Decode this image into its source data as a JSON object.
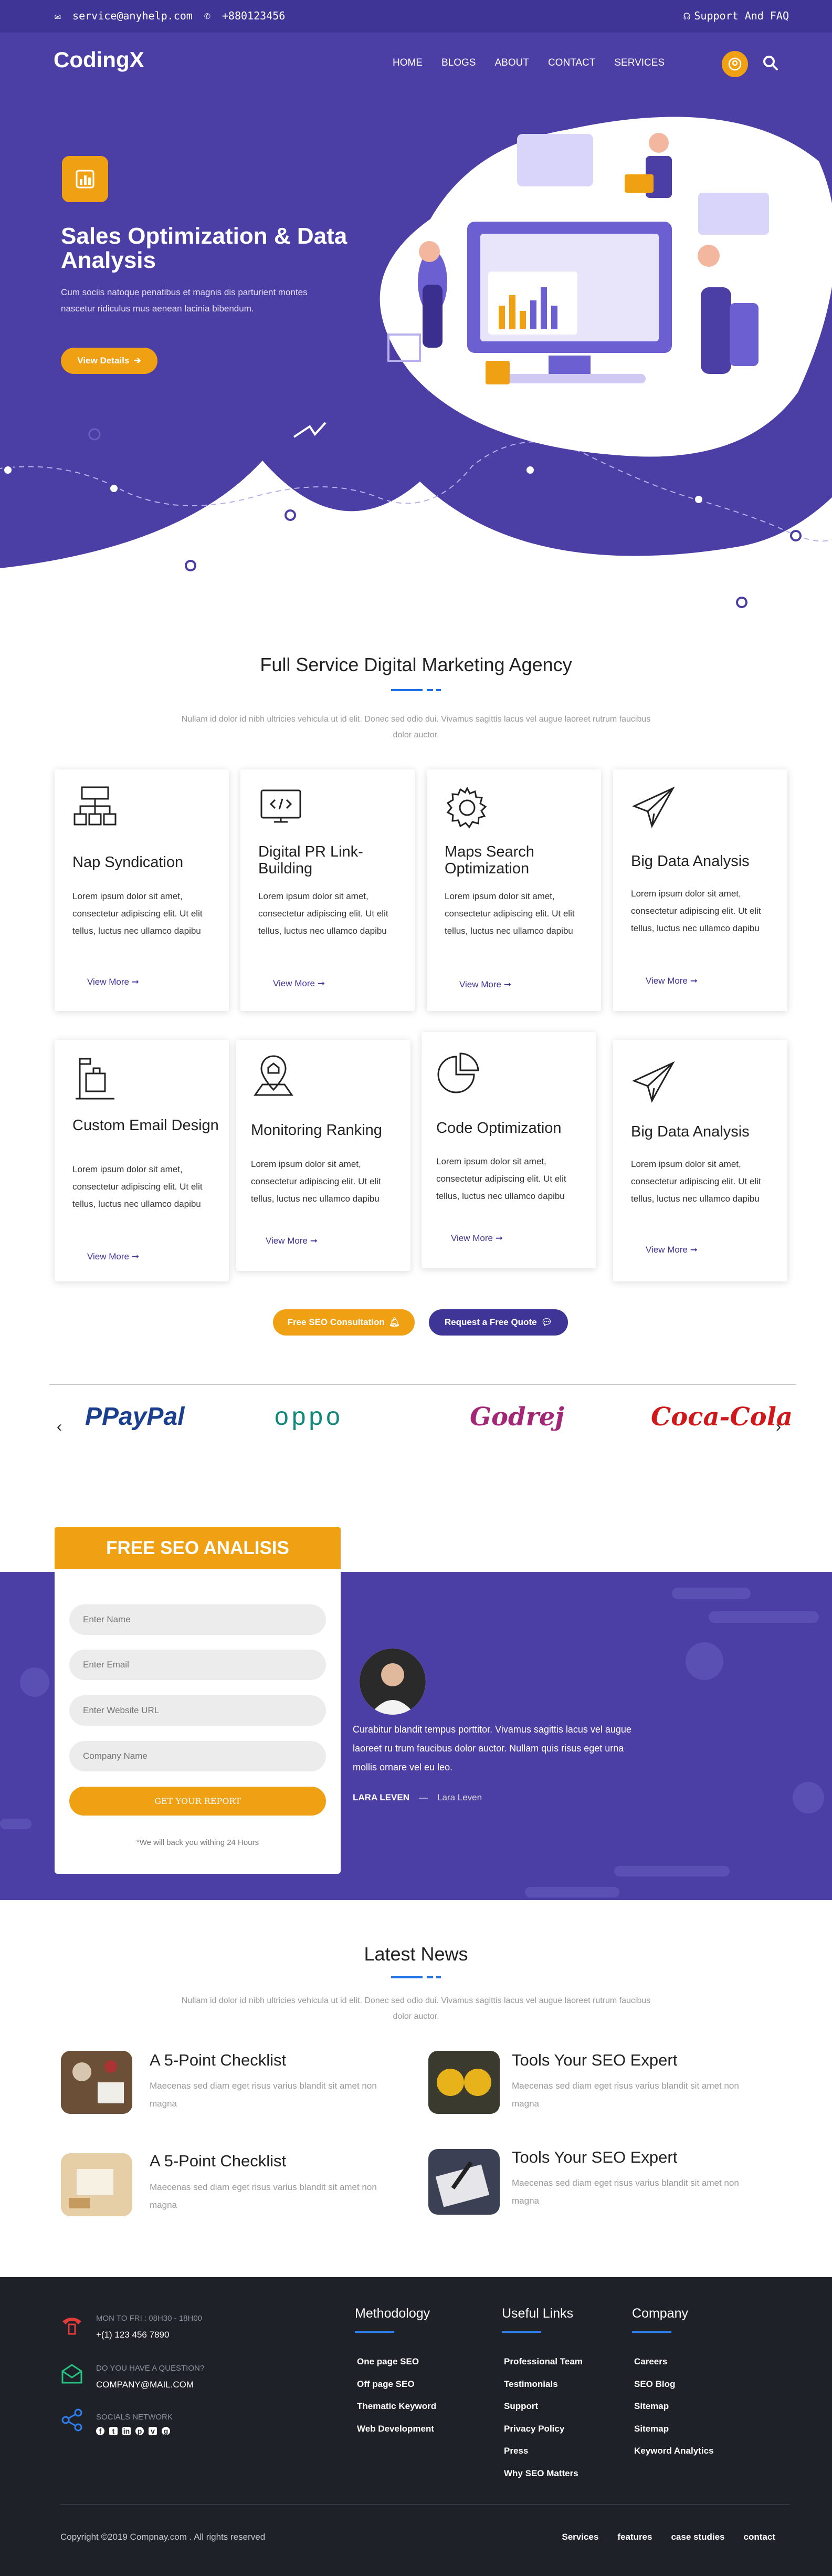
{
  "topbar": {
    "email": "service@anyhelp.com",
    "phone": "+880123456",
    "support": "Support And FAQ"
  },
  "nav": {
    "logo": "CodingX",
    "items": [
      "HOME",
      "BLOGS",
      "ABOUT",
      "CONTACT",
      "SERVICES"
    ]
  },
  "hero": {
    "title": "Sales Optimization & Data Analysis",
    "subtitle": "Cum sociis natoque penatibus et magnis dis parturient montes nascetur ridiculus mus aenean lacinia bibendum.",
    "button": "View Details"
  },
  "services": {
    "title": "Full Service Digital Marketing Agency",
    "desc": "Nullam id dolor id nibh ultricies vehicula ut id elit. Donec sed odio dui. Vivamus sagittis lacus vel augue laoreet rutrum faucibus dolor auctor.",
    "cards": [
      {
        "title": "Nap Syndication",
        "text": "Lorem ipsum dolor sit amet, consectetur adipiscing elit. Ut elit tellus, luctus nec ullamco dapibu",
        "link": "View More"
      },
      {
        "title": "Digital PR Link-Building",
        "text": "Lorem ipsum dolor sit amet, consectetur adipiscing elit. Ut elit tellus, luctus nec ullamco dapibu",
        "link": "View More"
      },
      {
        "title": "Maps Search Optimization",
        "text": "Lorem ipsum dolor sit amet, consectetur adipiscing elit. Ut elit tellus, luctus nec ullamco dapibu",
        "link": "View More"
      },
      {
        "title": "Big Data Analysis",
        "text": "Lorem ipsum dolor sit amet, consectetur adipiscing elit. Ut elit tellus, luctus nec ullamco dapibu",
        "link": "View More"
      },
      {
        "title": "Custom Email Design",
        "text": "Lorem ipsum dolor sit amet, consectetur adipiscing elit. Ut elit tellus, luctus nec ullamco dapibu",
        "link": "View More"
      },
      {
        "title": "Monitoring Ranking",
        "text": "Lorem ipsum dolor sit amet, consectetur adipiscing elit. Ut elit tellus, luctus nec ullamco dapibu",
        "link": "View More"
      },
      {
        "title": "Code Optimization",
        "text": "Lorem ipsum dolor sit amet, consectetur adipiscing elit. Ut elit tellus, luctus nec ullamco dapibu",
        "link": "View More"
      },
      {
        "title": "Big Data Analysis",
        "text": "Lorem ipsum dolor sit amet, consectetur adipiscing elit. Ut elit tellus, luctus nec ullamco dapibu",
        "link": "View More"
      }
    ],
    "cta_primary": "Free SEO Consultation",
    "cta_secondary": "Request a Free Quote"
  },
  "brands": [
    "PayPal",
    "oppo",
    "Godrej",
    "Coca-Cola"
  ],
  "seo_form": {
    "title": "FREE SEO ANALISIS",
    "placeholders": [
      "Enter Name",
      "Enter Email",
      "Enter Website URL",
      "Company Name"
    ],
    "button": "GET YOUR REPORT",
    "note": "*We will back you withing 24 Hours"
  },
  "testimonial": {
    "quote": "Curabitur blandit tempus porttitor. Vivamus sagittis lacus vel augue laoreet ru  trum faucibus dolor auctor. Nullam quis risus eget urna mollis ornare vel eu leo.",
    "name": "LARA LEVEN",
    "role": "Lara Leven"
  },
  "news": {
    "title": "Latest News",
    "desc": "Nullam id dolor id nibh ultricies vehicula ut id elit. Donec sed odio dui. Vivamus sagittis lacus vel augue laoreet rutrum faucibus dolor auctor.",
    "items": [
      {
        "title": "A 5-Point Checklist",
        "text": "Maecenas sed diam eget risus varius blandit sit amet non magna"
      },
      {
        "title": "Tools Your SEO Expert",
        "text": "Maecenas sed diam eget risus varius blandit sit amet non magna"
      },
      {
        "title": "A 5-Point Checklist",
        "text": "Maecenas sed diam eget risus varius blandit sit amet non magna"
      },
      {
        "title": "Tools Your SEO Expert",
        "text": "Maecenas sed diam eget risus varius blandit sit amet non magna"
      }
    ]
  },
  "footer": {
    "contact": [
      {
        "label": "MON TO FRI : 08H30 - 18H00",
        "value": "+(1) 123 456 7890"
      },
      {
        "label": "DO YOU HAVE A QUESTION?",
        "value": "COMPANY@MAIL.COM"
      },
      {
        "label": "SOCIALS NETWORK",
        "value": ""
      }
    ],
    "columns": [
      {
        "title": "Methodology",
        "links": [
          "One page SEO",
          "Off page SEO",
          "Thematic Keyword",
          "Web Development"
        ]
      },
      {
        "title": "Useful Links",
        "links": [
          "Professional Team",
          "Testimonials",
          "Support",
          "Privacy Policy",
          "Press",
          "Why SEO Matters"
        ]
      },
      {
        "title": "Company",
        "links": [
          "Careers",
          "SEO Blog",
          "Sitemap",
          "Sitemap",
          "Keyword Analytics"
        ]
      }
    ],
    "copyright": "Copyright ©2019 Compnay.com . All rights reserved",
    "bottom_links": [
      "Services",
      "features",
      "case studies",
      "contact"
    ]
  },
  "colors": {
    "primary": "#4b3fa6",
    "accent": "#f0a113",
    "underline": "#1f6fe5",
    "footer": "#1e2128"
  }
}
